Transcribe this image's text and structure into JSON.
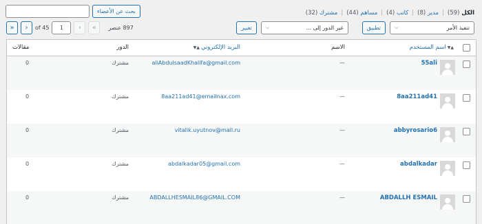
{
  "filters": [
    {
      "label": "الكل",
      "count": "(59)",
      "current": true
    },
    {
      "label": "مدير",
      "count": "(8)",
      "current": false
    },
    {
      "label": "كاتب",
      "count": "(4)",
      "current": false
    },
    {
      "label": "مساهم",
      "count": "(44)",
      "current": false
    },
    {
      "label": "مشترك",
      "count": "(32)",
      "current": false
    }
  ],
  "filter_separator": "|",
  "search": {
    "value": "",
    "button_label": "بحث عن الأعضاء"
  },
  "bulk_actions": {
    "selected": "تنفيذ الأمر",
    "apply_label": "تطبيق"
  },
  "change_role": {
    "selected": "غير الدور إلى ...",
    "button_label": "تغيير"
  },
  "pagination": {
    "items_count": "897 عنصر",
    "current_page": "1",
    "of_label": "of 45",
    "first_glyph": "«",
    "prev_glyph": "‹",
    "next_glyph": "›",
    "last_glyph": "»"
  },
  "columns": {
    "username": "اسم المستخدم",
    "name": "الاسم",
    "email": "البريد الإلكتروني",
    "role": "الدور",
    "posts": "مقالات"
  },
  "rows": [
    {
      "username": "55ali",
      "name": "—",
      "email": "aliAbdulsaadKhalifa@gmail.com",
      "role": "مشترك",
      "posts": "0"
    },
    {
      "username": "8aa211ad41",
      "name": "—",
      "email": "8aa211ad41@emailnax.com",
      "role": "مشترك",
      "posts": "0"
    },
    {
      "username": "abbyrosario6",
      "name": "—",
      "email": "vitalik.uyutnov@mail.ru",
      "role": "مشترك",
      "posts": "0"
    },
    {
      "username": "abdalkadar",
      "name": "—",
      "email": "abdalkadar05@gmail.com",
      "role": "مشترك",
      "posts": "0"
    },
    {
      "username": "ABDALLH ESMAIL",
      "name": "—",
      "email": "ABDALLHESMAIL86@GMAIL.COM",
      "role": "مشترك",
      "posts": "0"
    }
  ],
  "colors": {
    "link": "#2271b1",
    "border": "#c3c4c7",
    "background": "#f0f0f1"
  }
}
